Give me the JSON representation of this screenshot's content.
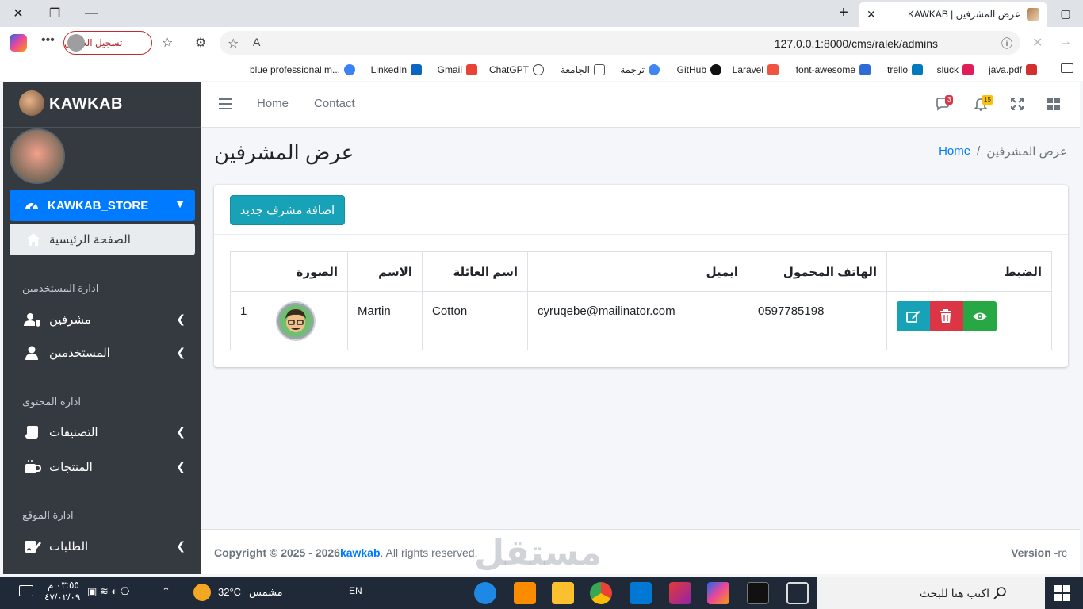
{
  "browser": {
    "tab_title": "عرض المشرفين | KAWKAB",
    "url": "127.0.0.1:8000/cms/ralek/admins",
    "signin_label": "تسجيل الدخول",
    "bookmarks": [
      {
        "label": "java.pdf",
        "icon": "pdf-icon",
        "color": "#d32f2f"
      },
      {
        "label": "sluck",
        "icon": "slack-icon",
        "color": "#e01e5a"
      },
      {
        "label": "trello",
        "icon": "trello-icon",
        "color": "#0079bf"
      },
      {
        "label": "font-awesome",
        "icon": "flag-icon",
        "color": "#2e6bd6"
      },
      {
        "label": "Laravel",
        "icon": "laravel-icon",
        "color": "#f05340"
      },
      {
        "label": "GitHub",
        "icon": "github-icon",
        "color": "#111111"
      },
      {
        "label": "ترجمة",
        "icon": "google-icon",
        "color": "#4285f4"
      },
      {
        "label": "الجامعة",
        "icon": "folder-icon",
        "color": "#555555"
      },
      {
        "label": "ChatGPT",
        "icon": "chatgpt-icon",
        "color": "#444444"
      },
      {
        "label": "Gmail",
        "icon": "gmail-icon",
        "color": "#ea4335"
      },
      {
        "label": "LinkedIn",
        "icon": "linkedin-icon",
        "color": "#0a66c2"
      },
      {
        "label": "blue professional m...",
        "icon": "edge-icon",
        "color": "#3b82f6"
      }
    ]
  },
  "sidebar": {
    "brand": "KAWKAB",
    "store_label": "KAWKAB_STORE",
    "home_label": "الصفحة الرئيسية",
    "sections": [
      {
        "title": "ادارة المستخدمين",
        "items": [
          {
            "label": "مشرفين",
            "icon": "user-shield-icon"
          },
          {
            "label": "المستخدمين",
            "icon": "user-icon"
          }
        ]
      },
      {
        "title": "ادارة المحتوى",
        "items": [
          {
            "label": "التصنيفات",
            "icon": "scroll-icon"
          },
          {
            "label": "المنتجات",
            "icon": "mug-icon"
          }
        ]
      },
      {
        "title": "ادارة الموقع",
        "items": [
          {
            "label": "الطلبات",
            "icon": "edit-signature-icon"
          }
        ]
      }
    ]
  },
  "header": {
    "nav_home": "Home",
    "nav_contact": "Contact",
    "messages_count": "3",
    "notifications_count": "15"
  },
  "page": {
    "title": "عرض المشرفين",
    "breadcrumb_home": "Home",
    "breadcrumb_sep": "/",
    "breadcrumb_current": "عرض المشرفين",
    "add_button": "اضافة مشرف جديد"
  },
  "table": {
    "headers": [
      "",
      "الصورة",
      "الاسم",
      "اسم العائلة",
      "ايميل",
      "الهاتف المحمول",
      "الضبط"
    ],
    "rows": [
      {
        "index": "1",
        "first_name": "Martin",
        "last_name": "Cotton",
        "email": "cyruqebe@mailinator.com",
        "mobile": "0597785198"
      }
    ]
  },
  "colors": {
    "primary": "#007bff",
    "info": "#17a2b8",
    "danger": "#dc3545",
    "success": "#28a745",
    "sidebar": "#343a40"
  },
  "footer": {
    "copyright": "Copyright © 2025 - 2026",
    "brand": "kawkab",
    "rights": ". All rights reserved.",
    "version_label": "Version",
    "version_value": "-rc"
  },
  "watermark": "مستقل",
  "taskbar": {
    "time": "٠٣:٥٥ م",
    "date": "٤٧/٠٢/٠٩",
    "temperature": "32°C",
    "weather": "مشمس",
    "language": "EN",
    "search_placeholder": "اكتب هنا للبحث"
  }
}
